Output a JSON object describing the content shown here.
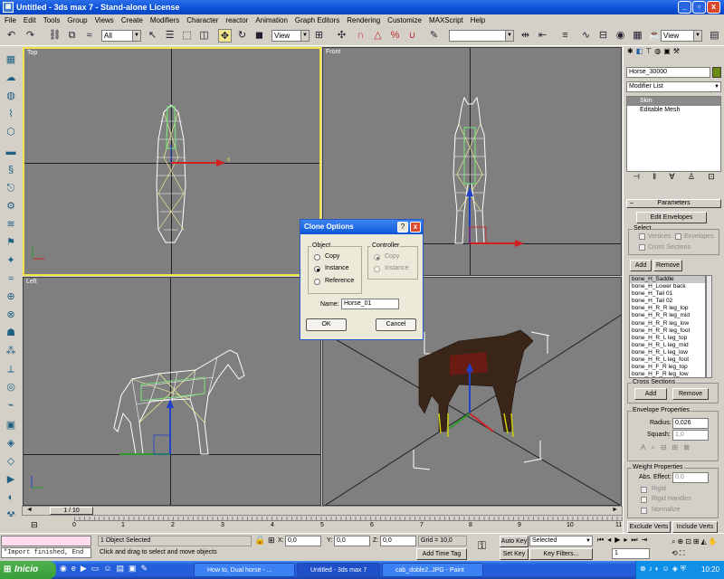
{
  "window": {
    "title": "Untitled - 3ds max 7 - Stand-alone License",
    "icon_name": "app-icon",
    "buttons": [
      "_",
      "▫",
      "x"
    ]
  },
  "menu": [
    "File",
    "Edit",
    "Tools",
    "Group",
    "Views",
    "Create",
    "Modifiers",
    "Character",
    "reactor",
    "Animation",
    "Graph Editors",
    "Rendering",
    "Customize",
    "MAXScript",
    "Help"
  ],
  "toolbar": {
    "selection_filter": "All",
    "ref_coord_1": "View",
    "ref_coord_2": "View",
    "selection_set": ""
  },
  "viewports": {
    "top_left": "Top",
    "top_right": "Front",
    "bottom_left": "Left",
    "bottom_right": "",
    "active_border_color": "#f2e447",
    "background_color": "#7f7f7f"
  },
  "command_panel": {
    "object_name": "Horse_30000",
    "object_color": "#6a8a10",
    "modifier_list_label": "Modifier List",
    "stack": [
      "Skin",
      "Editable Mesh"
    ],
    "rollout_parameters": "Parameters",
    "edit_envelopes": "Edit Envelopes",
    "select_group": "Select",
    "vertices_label": "Vertices",
    "envelopes_label": "Envelopes",
    "cross_sections_label": "Cross Sections",
    "add": "Add",
    "remove": "Remove",
    "bones": [
      "bone_H_Saddle",
      "bone_H_Lower back",
      "bone_H_Tail 01",
      "bone_H_Tail 02",
      "bone_H_R_R leg_top",
      "bone_H_R_R leg_mid",
      "bone_H_R_R leg_low",
      "bone_H_R_R leg_foot",
      "bone_H_R_L leg_top",
      "bone_H_R_L leg_mid",
      "bone_H_R_L leg_low",
      "bone_H_R_L leg_foot",
      "bone_H_F_R leg_top",
      "bone_H_F_R leg_low"
    ],
    "cross_sections_group": "Cross Sections",
    "cs_add": "Add",
    "cs_remove": "Remove",
    "envelope_properties": "Envelope Properties",
    "radius_label": "Radius:",
    "radius_value": "0,026",
    "squash_label": "Squash:",
    "squash_value": "1,0",
    "weight_properties": "Weight Properties",
    "abs_effect_label": "Abs. Effect:",
    "abs_effect_value": "0,0",
    "rigid_label": "Rigid",
    "rigid_handles_label": "Rigid Handles",
    "normalize_label": "Normalize",
    "exclude_verts": "Exclude Verts",
    "include_verts": "Include Verts"
  },
  "dialog": {
    "title": "Clone Options",
    "help": "?",
    "close": "x",
    "object_group": "Object",
    "controller_group": "Controller",
    "object_options": [
      "Copy",
      "Instance",
      "Reference"
    ],
    "object_selected": "Instance",
    "controller_options": [
      "Copy",
      "Instance"
    ],
    "name_label": "Name:",
    "name_value": "Horse_01",
    "ok": "OK",
    "cancel": "Cancel"
  },
  "timeline": {
    "slider_label": "1 / 10",
    "current_frame": 1,
    "total_frames": 10,
    "ticks": [
      "0",
      "1",
      "2",
      "3",
      "4",
      "5",
      "6",
      "7",
      "8",
      "9",
      "10",
      "11"
    ]
  },
  "status": {
    "maxscript": "\"Import finished, End",
    "selection_count": "1 Object Selected",
    "prompt": "Click and drag to select and move objects",
    "x_label": "X:",
    "x_value": "0,0",
    "y_label": "Y:",
    "y_value": "0,0",
    "z_label": "Z:",
    "z_value": "0,0",
    "grid": "Grid = 10,0",
    "add_time_tag": "Add Time Tag",
    "auto_key": "Auto Key",
    "auto_key_mode": "Selected",
    "set_key": "Set Key",
    "key_filters": "Key Filters...",
    "frame_value": "1"
  },
  "taskbar": {
    "start": "Inicio",
    "tasks": [
      "How to, Dual horse - ...",
      "Untitled - 3ds max 7",
      "cab_doble2..JPG - Paint"
    ],
    "active_task": 1,
    "clock": "10:20"
  }
}
